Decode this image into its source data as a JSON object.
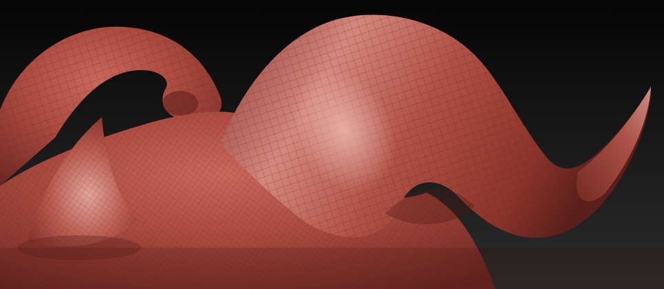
{
  "scene": {
    "subject": "sculpted-mesh",
    "colors": {
      "background_top": "#050505",
      "background_bottom": "#2c2c2c",
      "clay_base": "#a84a3f",
      "clay_light": "#d98a80",
      "clay_dark": "#5a1f1a",
      "wire": "#6e2a24"
    }
  }
}
